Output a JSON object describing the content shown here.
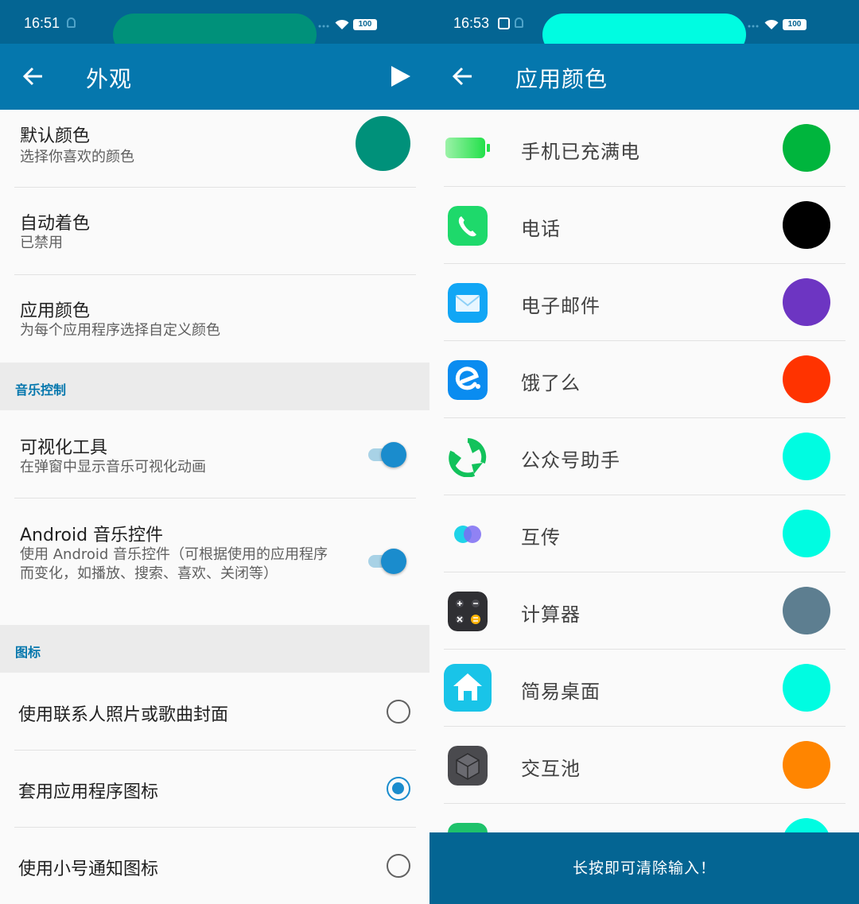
{
  "left": {
    "status": {
      "time": "16:51",
      "battery": "100"
    },
    "appbar": {
      "title": "外观"
    },
    "colors": {
      "status_bar": "#046593",
      "app_bar": "#0577ad",
      "pill": "#00917a",
      "accent": "#1a8ccd",
      "default_color": "#00917a"
    },
    "items": [
      {
        "title": "默认颜色",
        "subtitle": "选择你喜欢的颜色"
      },
      {
        "title": "自动着色",
        "subtitle": "已禁用"
      },
      {
        "title": "应用颜色",
        "subtitle": "为每个应用程序选择自定义颜色"
      }
    ],
    "music_section": {
      "label": "音乐控制",
      "items": [
        {
          "title": "可视化工具",
          "subtitle": "在弹窗中显示音乐可视化动画",
          "enabled": true
        },
        {
          "title": "Android 音乐控件",
          "subtitle": "使用 Android 音乐控件（可根据使用的应用程序而变化，如播放、搜索、喜欢、关闭等）",
          "enabled": true
        }
      ]
    },
    "icon_section": {
      "label": "图标",
      "options": [
        {
          "label": "使用联系人照片或歌曲封面",
          "selected": false
        },
        {
          "label": "套用应用程序图标",
          "selected": true
        },
        {
          "label": "使用小号通知图标",
          "selected": false
        }
      ]
    }
  },
  "right": {
    "status": {
      "time": "16:53",
      "battery": "100"
    },
    "appbar": {
      "title": "应用颜色"
    },
    "colors": {
      "pill": "#00fce1"
    },
    "apps": [
      {
        "name": "手机已充满电",
        "icon": "battery-full-icon",
        "color": "#00b53d"
      },
      {
        "name": "电话",
        "icon": "phone-icon",
        "color": "#000000"
      },
      {
        "name": "电子邮件",
        "icon": "email-icon",
        "color": "#6d35c2"
      },
      {
        "name": "饿了么",
        "icon": "eleme-icon",
        "color": "#ff3300"
      },
      {
        "name": "公众号助手",
        "icon": "wechat-assistant-icon",
        "color": "#00fce1"
      },
      {
        "name": "互传",
        "icon": "transfer-icon",
        "color": "#00fce1"
      },
      {
        "name": "计算器",
        "icon": "calculator-icon",
        "color": "#5d7e90"
      },
      {
        "name": "简易桌面",
        "icon": "simple-launcher-icon",
        "color": "#00fce1"
      },
      {
        "name": "交互池",
        "icon": "interaction-pool-icon",
        "color": "#ff8500"
      },
      {
        "name": "",
        "icon": "partial-app-icon",
        "color": "#00fce1"
      }
    ],
    "toast": "长按即可清除输入！"
  }
}
